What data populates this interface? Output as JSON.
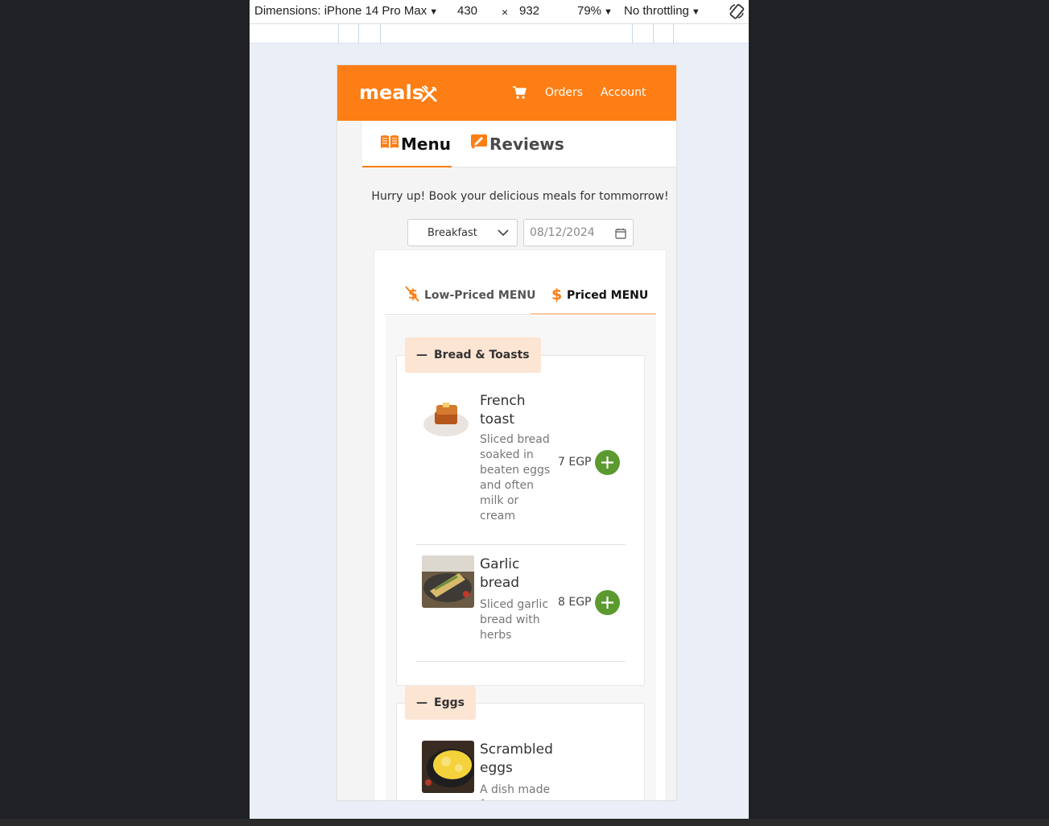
{
  "devtools": {
    "dimensions_label": "Dimensions: iPhone 14 Pro Max",
    "width": "430",
    "times": "×",
    "height": "932",
    "zoom": "79%",
    "throttling": "No throttling"
  },
  "navbar": {
    "logo": "meals",
    "logo_icon": "utensils-icon",
    "cart_icon": "cart-icon",
    "orders_label": "Orders",
    "account_label": "Account",
    "accent": "#fd7e14"
  },
  "tabs": {
    "menu_label": "Menu",
    "reviews_label": "Reviews"
  },
  "booking": {
    "hurry_text": "Hurry up! Book your delicious meals for tommorrow!",
    "meal_type": "Breakfast",
    "date": "08/12/2024"
  },
  "menu_tabs": {
    "low_label": "Low-Priced MENU",
    "priced_label": "Priced MENU"
  },
  "categories": [
    {
      "name": "Bread & Toasts",
      "items": [
        {
          "name": "French toast",
          "description": "Sliced bread soaked in beaten eggs and often milk or cream",
          "price": "7 EGP"
        },
        {
          "name": "Garlic bread",
          "description": "Sliced garlic bread with herbs",
          "price": "8 EGP"
        }
      ]
    },
    {
      "name": "Eggs",
      "items": [
        {
          "name": "Scrambled eggs",
          "description": "A dish made f",
          "price": ""
        }
      ]
    }
  ],
  "colors": {
    "add_button": "#5a9a2e",
    "category_header_bg": "#fde5d4"
  }
}
